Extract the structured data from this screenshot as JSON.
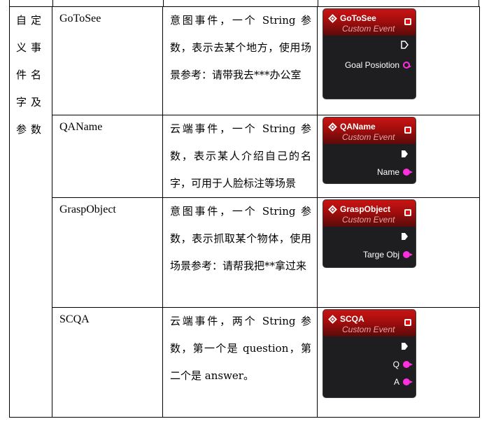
{
  "row_label": [
    "自定",
    "义事",
    "件名",
    "字及",
    "参数"
  ],
  "rows": [
    {
      "name": "GoToSee",
      "desc": "意图事件，一个 String 参数，表示去某个地方，使用场景参考：请带我去***办公室",
      "node": {
        "title": "GoToSee",
        "subtitle": "Custom Event",
        "exec_style": "hollow",
        "pins": [
          {
            "label": "Goal Posiotion",
            "style": "hollow"
          }
        ]
      }
    },
    {
      "name": "QAName",
      "desc": "云端事件，一个 String 参数，表示某人介绍自己的名字，可用于人脸标注等场景",
      "node": {
        "title": "QAName",
        "subtitle": "Custom Event",
        "exec_style": "filled",
        "pins": [
          {
            "label": "Name",
            "style": "filled"
          }
        ]
      }
    },
    {
      "name": "GraspObject",
      "desc": "意图事件，一个 String 参数，表示抓取某个物体，使用场景参考：请帮我把**拿过来",
      "node": {
        "title": "GraspObject",
        "subtitle": "Custom Event",
        "exec_style": "filled",
        "pins": [
          {
            "label": "Targe Obj",
            "style": "filled"
          }
        ]
      }
    },
    {
      "name": "SCQA",
      "desc": "云端事件，两个 String 参数，第一个是 question，第二个是 answer。",
      "node": {
        "title": "SCQA",
        "subtitle": "Custom Event",
        "exec_style": "filled",
        "pins": [
          {
            "label": "Q",
            "style": "filled"
          },
          {
            "label": "A",
            "style": "filled"
          }
        ]
      }
    }
  ],
  "colors": {
    "node_bg": "#1e1e20",
    "header_red": "#c81414",
    "pin_magenta": "#ff2ee0"
  },
  "icons": {
    "event_icon": "diamond-icon",
    "delegate_pin": "delegate-pin-icon",
    "exec_pin": "exec-pin-icon"
  }
}
